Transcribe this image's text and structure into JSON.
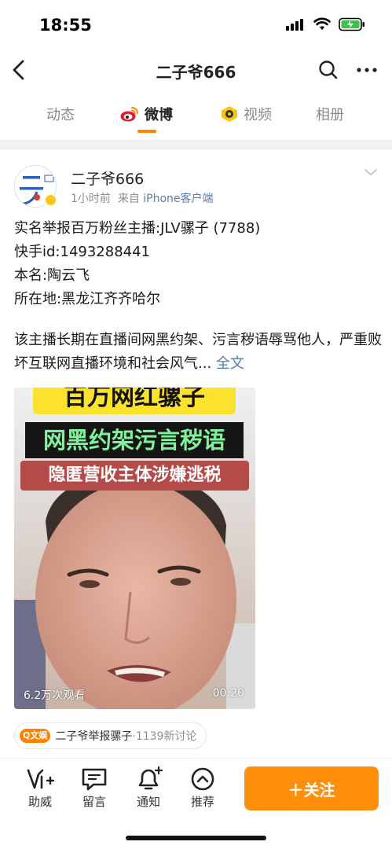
{
  "status": {
    "time": "18:55"
  },
  "nav": {
    "title": "二子爷666",
    "back_icon": "chevron-left-icon",
    "search_icon": "search-icon",
    "more_icon": "more-icon"
  },
  "tabs": [
    {
      "label": "动态",
      "active": false
    },
    {
      "label": "微博",
      "active": true
    },
    {
      "label": "视频",
      "active": false
    },
    {
      "label": "相册",
      "active": false
    }
  ],
  "post": {
    "author": "二子爷666",
    "time": "1小时前",
    "source_prefix": "来自",
    "source": "iPhone客户端",
    "lines": [
      "实名举报百万粉丝主播:JLV骡子 (7788)",
      "快手id:1493288441",
      "本名:陶云飞",
      "所在地:黑龙江齐齐哈尔"
    ],
    "body": "该主播长期在直播间网黑约架、污言秽语辱骂他人，严重败坏互联网直播环境和社会风气...",
    "fulltext_label": "全文",
    "video": {
      "banner1": "百万网红骡子",
      "banner2": "网黑约架污言秽语",
      "banner3": "隐匿营收主体涉嫌逃税",
      "views": "6.2万次观看",
      "duration": "00:20"
    },
    "topic": {
      "badge": "Q文娱",
      "title": "二子爷举报骡子",
      "separator": "·",
      "count": "1139新讨论"
    }
  },
  "actions": [
    {
      "label": "助威",
      "icon": "cheer-icon"
    },
    {
      "label": "留言",
      "icon": "comment-icon"
    },
    {
      "label": "通知",
      "icon": "bell-icon"
    },
    {
      "label": "推荐",
      "icon": "recommend-icon"
    }
  ],
  "follow": {
    "label": "＋关注"
  },
  "colors": {
    "accent": "#ff8200",
    "link": "#507daf",
    "follow_bg": "#ff8f0a"
  }
}
